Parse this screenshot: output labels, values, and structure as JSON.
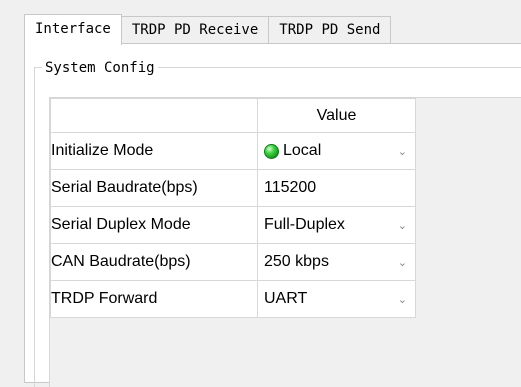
{
  "tabs": [
    {
      "label": "Interface"
    },
    {
      "label": "TRDP PD Receive"
    },
    {
      "label": "TRDP PD Send"
    }
  ],
  "group": {
    "title": "System Config"
  },
  "grid": {
    "value_header": "Value",
    "rows": [
      {
        "label": "Initialize Mode",
        "value": "Local",
        "dropdown": true,
        "status_color": "#2fbf3a"
      },
      {
        "label": "Serial Baudrate(bps)",
        "value": "115200",
        "dropdown": false
      },
      {
        "label": "Serial Duplex Mode",
        "value": "Full-Duplex",
        "dropdown": true
      },
      {
        "label": "CAN Baudrate(bps)",
        "value": "250 kbps",
        "dropdown": true
      },
      {
        "label": "TRDP Forward",
        "value": "UART",
        "dropdown": true
      }
    ]
  }
}
